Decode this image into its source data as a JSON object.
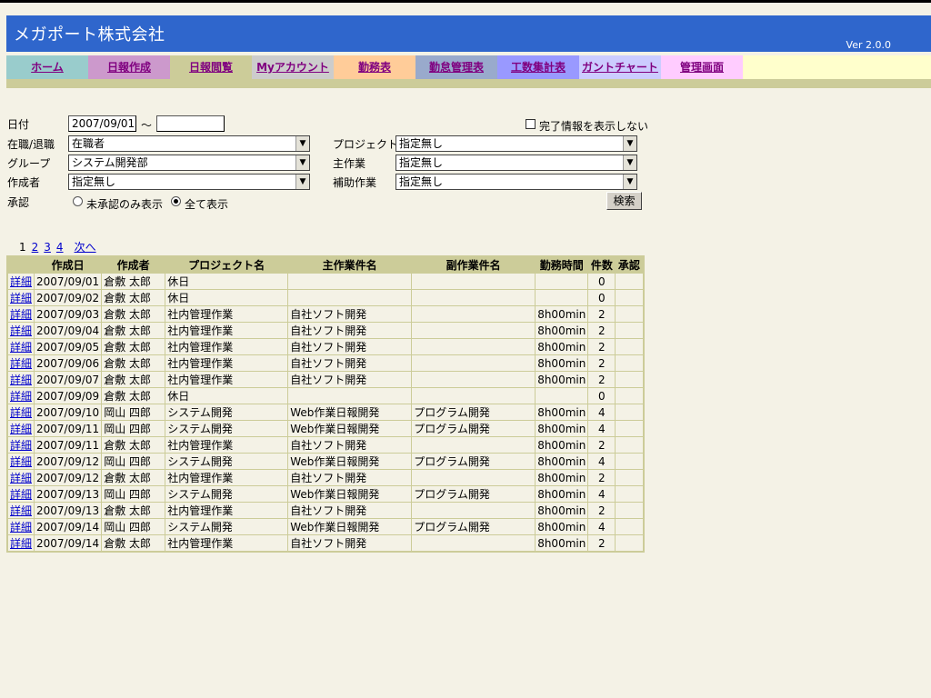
{
  "app": {
    "title": "メガポート株式会社",
    "version": "Ver 2.0.0"
  },
  "nav": [
    {
      "label": "ホーム",
      "bg": "#99cccc"
    },
    {
      "label": "日報作成",
      "bg": "#cc99cc"
    },
    {
      "label": "日報閲覧",
      "bg": "#cccc99"
    },
    {
      "label": "Myアカウント",
      "bg": "#cccccc"
    },
    {
      "label": "勤務表",
      "bg": "#ffcc99"
    },
    {
      "label": "勤怠管理表",
      "bg": "#99aacc"
    },
    {
      "label": "工数集計表",
      "bg": "#9999ff"
    },
    {
      "label": "ガントチャート",
      "bg": "#ccccff"
    },
    {
      "label": "管理画面",
      "bg": "#ffccff"
    }
  ],
  "filters": {
    "date_label": "日付",
    "date_from": "2007/09/01",
    "date_sep": "～",
    "date_to": "",
    "hide_complete_label": "完了情報を表示しない",
    "employment_label": "在職/退職",
    "employment_value": "在職者",
    "project_label": "プロジェクト",
    "project_value": "指定無し",
    "group_label": "グループ",
    "group_value": "システム開発部",
    "main_task_label": "主作業",
    "main_task_value": "指定無し",
    "author_label": "作成者",
    "author_value": "指定無し",
    "sub_task_label": "補助作業",
    "sub_task_value": "指定無し",
    "approval_label": "承認",
    "approval_opt1": "未承認のみ表示",
    "approval_opt2": "全て表示",
    "search_button": "検索"
  },
  "pager": {
    "current": "1",
    "pages": [
      "2",
      "3",
      "4"
    ],
    "next": "次へ"
  },
  "table": {
    "headers": [
      "",
      "作成日",
      "作成者",
      "プロジェクト名",
      "主作業件名",
      "副作業件名",
      "勤務時間",
      "件数",
      "承認"
    ],
    "detail_label": "詳細",
    "rows": [
      [
        "2007/09/01",
        "倉敷 太郎",
        "休日",
        "",
        "",
        "",
        "0",
        ""
      ],
      [
        "2007/09/02",
        "倉敷 太郎",
        "休日",
        "",
        "",
        "",
        "0",
        ""
      ],
      [
        "2007/09/03",
        "倉敷 太郎",
        "社内管理作業",
        "自社ソフト開発",
        "",
        "8h00min",
        "2",
        ""
      ],
      [
        "2007/09/04",
        "倉敷 太郎",
        "社内管理作業",
        "自社ソフト開発",
        "",
        "8h00min",
        "2",
        ""
      ],
      [
        "2007/09/05",
        "倉敷 太郎",
        "社内管理作業",
        "自社ソフト開発",
        "",
        "8h00min",
        "2",
        ""
      ],
      [
        "2007/09/06",
        "倉敷 太郎",
        "社内管理作業",
        "自社ソフト開発",
        "",
        "8h00min",
        "2",
        ""
      ],
      [
        "2007/09/07",
        "倉敷 太郎",
        "社内管理作業",
        "自社ソフト開発",
        "",
        "8h00min",
        "2",
        ""
      ],
      [
        "2007/09/09",
        "倉敷 太郎",
        "休日",
        "",
        "",
        "",
        "0",
        ""
      ],
      [
        "2007/09/10",
        "岡山 四郎",
        "システム開発",
        "Web作業日報開発",
        "プログラム開発",
        "8h00min",
        "4",
        ""
      ],
      [
        "2007/09/11",
        "岡山 四郎",
        "システム開発",
        "Web作業日報開発",
        "プログラム開発",
        "8h00min",
        "4",
        ""
      ],
      [
        "2007/09/11",
        "倉敷 太郎",
        "社内管理作業",
        "自社ソフト開発",
        "",
        "8h00min",
        "2",
        ""
      ],
      [
        "2007/09/12",
        "岡山 四郎",
        "システム開発",
        "Web作業日報開発",
        "プログラム開発",
        "8h00min",
        "4",
        ""
      ],
      [
        "2007/09/12",
        "倉敷 太郎",
        "社内管理作業",
        "自社ソフト開発",
        "",
        "8h00min",
        "2",
        ""
      ],
      [
        "2007/09/13",
        "岡山 四郎",
        "システム開発",
        "Web作業日報開発",
        "プログラム開発",
        "8h00min",
        "4",
        ""
      ],
      [
        "2007/09/13",
        "倉敷 太郎",
        "社内管理作業",
        "自社ソフト開発",
        "",
        "8h00min",
        "2",
        ""
      ],
      [
        "2007/09/14",
        "岡山 四郎",
        "システム開発",
        "Web作業日報開発",
        "プログラム開発",
        "8h00min",
        "4",
        ""
      ],
      [
        "2007/09/14",
        "倉敷 太郎",
        "社内管理作業",
        "自社ソフト開発",
        "",
        "8h00min",
        "2",
        ""
      ]
    ]
  }
}
